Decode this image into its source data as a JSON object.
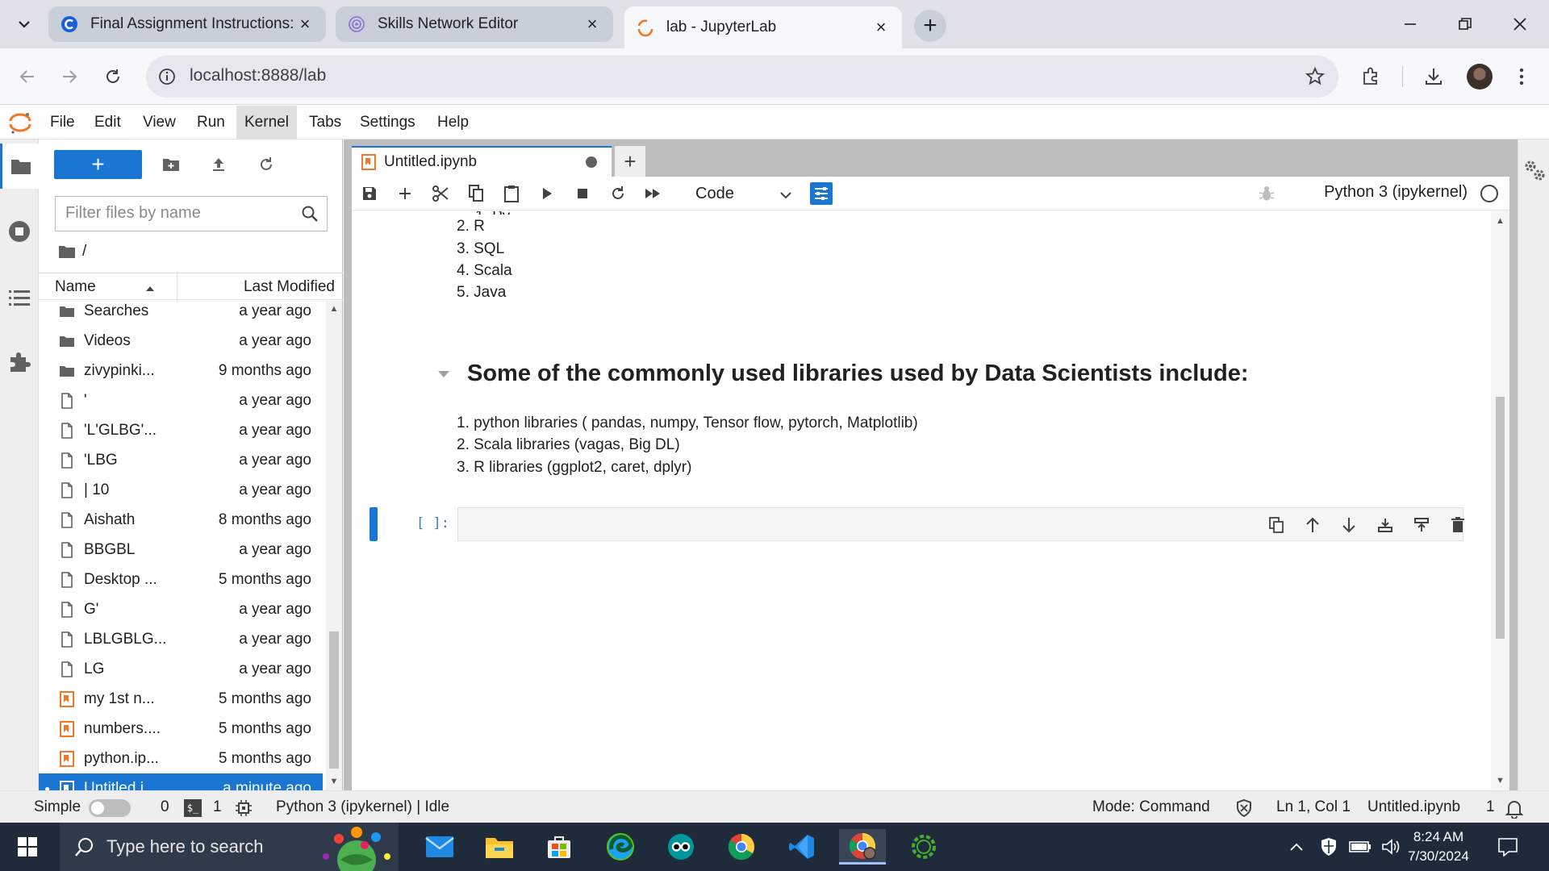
{
  "browser": {
    "tabs": [
      {
        "title": "Final Assignment Instructions: C",
        "state": "inactive"
      },
      {
        "title": "Skills Network Editor",
        "state": "inactive"
      },
      {
        "title": "lab - JupyterLab",
        "state": "active"
      }
    ],
    "url": "localhost:8888/lab"
  },
  "menu": [
    "File",
    "Edit",
    "View",
    "Run",
    "Kernel",
    "Tabs",
    "Settings",
    "Help"
  ],
  "filebrowser": {
    "filter_placeholder": "Filter files by name",
    "breadcrumb": "/",
    "col_name": "Name",
    "col_modified": "Last Modified",
    "rows": [
      {
        "name": "Searches",
        "modified": "a year ago",
        "kind": "folder"
      },
      {
        "name": "Videos",
        "modified": "a year ago",
        "kind": "folder"
      },
      {
        "name": "zivypinki...",
        "modified": "9 months ago",
        "kind": "folder"
      },
      {
        "name": "'",
        "modified": "a year ago",
        "kind": "file"
      },
      {
        "name": "'L'GLBG'...",
        "modified": "a year ago",
        "kind": "file"
      },
      {
        "name": "'LBG",
        "modified": "a year ago",
        "kind": "file"
      },
      {
        "name": "| 10",
        "modified": "a year ago",
        "kind": "file"
      },
      {
        "name": "Aishath",
        "modified": "8 months ago",
        "kind": "file"
      },
      {
        "name": "BBGBL",
        "modified": "a year ago",
        "kind": "file"
      },
      {
        "name": "Desktop ...",
        "modified": "5 months ago",
        "kind": "file"
      },
      {
        "name": "G'",
        "modified": "a year ago",
        "kind": "file"
      },
      {
        "name": "LBLGBLG...",
        "modified": "a year ago",
        "kind": "file"
      },
      {
        "name": "LG",
        "modified": "a year ago",
        "kind": "file"
      },
      {
        "name": "my 1st n...",
        "modified": "5 months ago",
        "kind": "notebook"
      },
      {
        "name": "numbers....",
        "modified": "5 months ago",
        "kind": "notebook"
      },
      {
        "name": "python.ip...",
        "modified": "5 months ago",
        "kind": "notebook"
      },
      {
        "name": "Untitled.i...",
        "modified": "a minute ago",
        "kind": "notebook",
        "selected": true
      }
    ]
  },
  "notebook": {
    "tab_title": "Untitled.ipynb",
    "cell_type": "Code",
    "kernel": "Python 3 (ipykernel)",
    "languages": [
      "2. R",
      "3. SQL",
      "4. Scala",
      "5. Java"
    ],
    "heading": "Some of the commonly used libraries used by Data Scientists include:",
    "libraries": [
      "1. python libraries ( pandas, numpy, Tensor flow, pytorch, Matplotlib)",
      "2. Scala libraries (vagas, Big DL)",
      "3. R libraries (ggplot2, caret, dplyr)"
    ],
    "prompt": "[ ]:"
  },
  "status": {
    "simple_label": "Simple",
    "terminals": "0",
    "consoles": "1",
    "kernel_state": "Python 3 (ipykernel) | Idle",
    "mode": "Mode: Command",
    "cursor": "Ln 1, Col 1",
    "file": "Untitled.ipynb",
    "notifications": "1"
  },
  "taskbar": {
    "search_placeholder": "Type here to search",
    "time": "8:24 AM",
    "date": "7/30/2024"
  },
  "colors": {
    "accent": "#1976d2",
    "jupyter_orange": "#f37726"
  }
}
